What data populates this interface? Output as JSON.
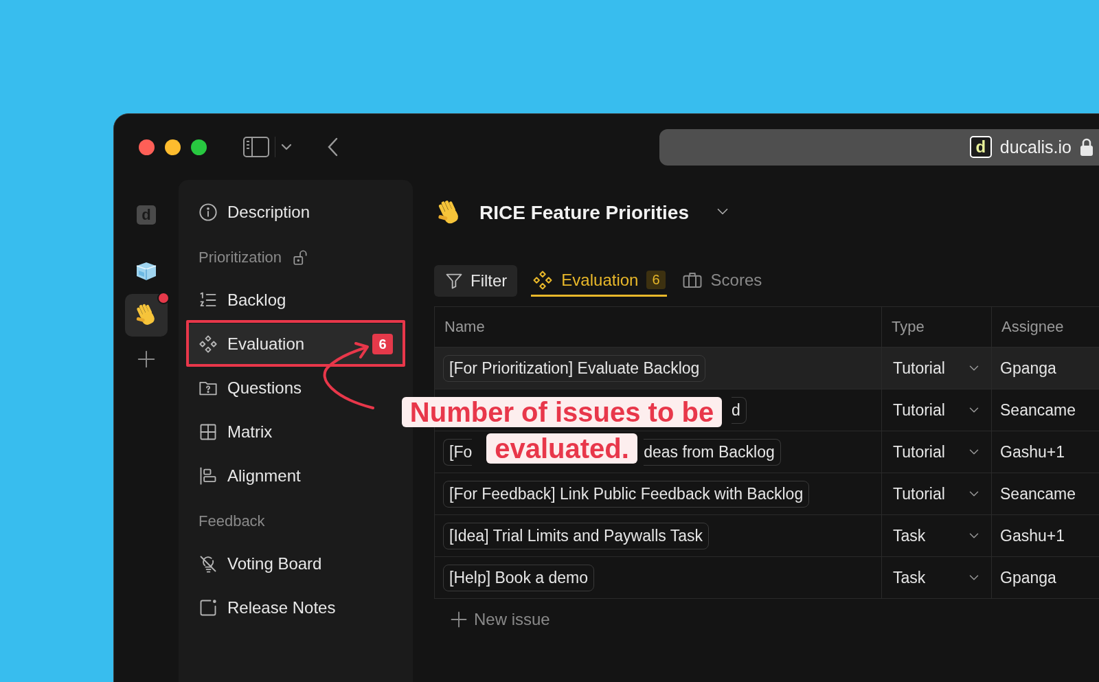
{
  "window": {
    "favicon_letter": "d",
    "url": "ducalis.io"
  },
  "rail": [
    {
      "kind": "logo",
      "letter": "d",
      "selected": false,
      "unread": false
    },
    {
      "kind": "cube",
      "selected": false,
      "unread": false
    },
    {
      "kind": "wave",
      "selected": true,
      "unread": true
    },
    {
      "kind": "add"
    }
  ],
  "sidebar": {
    "items": [
      {
        "kind": "info",
        "label": "Description",
        "selected": false,
        "highlighted": false
      },
      {
        "kind": "heading",
        "label": "Prioritization",
        "locked": false
      },
      {
        "kind": "list",
        "label": "Backlog",
        "selected": false,
        "highlighted": false
      },
      {
        "kind": "diamonds",
        "label": "Evaluation",
        "count": "6",
        "selected": true,
        "highlighted": true
      },
      {
        "kind": "question",
        "label": "Questions",
        "selected": false,
        "highlighted": false
      },
      {
        "kind": "grid",
        "label": "Matrix",
        "selected": false,
        "highlighted": false
      },
      {
        "kind": "align",
        "label": "Alignment",
        "selected": false,
        "highlighted": false
      },
      {
        "kind": "heading",
        "label": "Feedback"
      },
      {
        "kind": "bulb-off",
        "label": "Voting Board",
        "selected": false,
        "highlighted": false
      },
      {
        "kind": "note",
        "label": "Release Notes",
        "selected": false,
        "highlighted": false
      }
    ]
  },
  "main": {
    "title": "RICE Feature Priorities",
    "filter": {
      "label": "Filter"
    },
    "tabs": [
      {
        "kind": "diamonds",
        "label": "Evaluation",
        "count": "6",
        "selected": true
      },
      {
        "kind": "briefcase",
        "label": "Scores",
        "selected": false
      }
    ],
    "table": {
      "columns": [
        "Name",
        "Type",
        "Assignee"
      ],
      "rows": [
        {
          "name_head": "[For Prioritization] Evaluate Backlog",
          "type": "Tutorial",
          "assignee": "Gpanga",
          "selected": true
        },
        {
          "name_tail": "d",
          "type": "Tutorial",
          "assignee": "Seancame",
          "selected": false
        },
        {
          "name_head": "[Fo",
          "name_tail": "deas from Backlog",
          "type": "Tutorial",
          "assignee": "Gashu+1",
          "selected": false
        },
        {
          "name_head": "[For Feedback] Link Public Feedback with Backlog",
          "type": "Tutorial",
          "assignee": "Seancame",
          "selected": false
        },
        {
          "name_head": "[Idea] Trial Limits and Paywalls Task",
          "type": "Task",
          "assignee": "Gashu+1",
          "selected": false
        },
        {
          "name_head": "[Help] Book a demo",
          "type": "Task",
          "assignee": "Gpanga",
          "selected": false
        }
      ]
    },
    "new_issue": "New issue"
  },
  "annotation": {
    "lines": [
      "Number of issues to be",
      "evaluated."
    ]
  }
}
